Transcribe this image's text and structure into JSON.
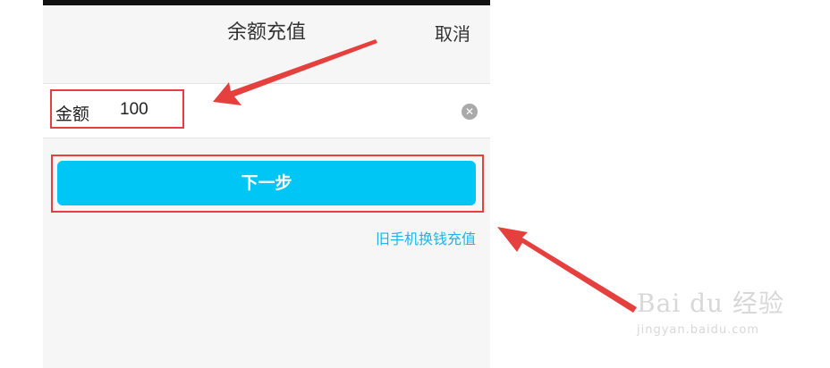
{
  "header": {
    "title": "余额充值",
    "cancel_label": "取消"
  },
  "amount_row": {
    "label": "金额",
    "value": "100",
    "clear_icon": "clear-circle-icon"
  },
  "next_button": {
    "label": "下一步"
  },
  "links": {
    "old_phone_recharge": "旧手机换钱充值"
  },
  "watermark": {
    "logo": "Bai du 经验",
    "url": "jingyan.baidu.com"
  },
  "colors": {
    "button": "#00c6f6",
    "link": "#1fb3ea",
    "highlight": "#e5403e",
    "background": "#f6f6f6"
  }
}
